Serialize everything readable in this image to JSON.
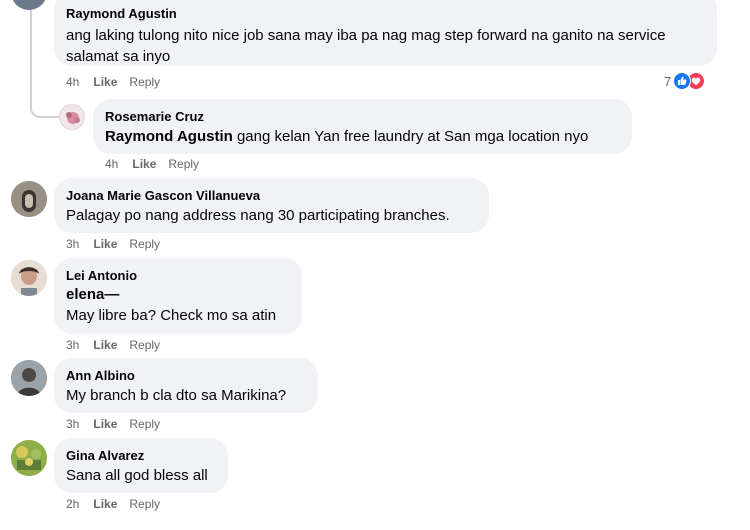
{
  "comments": [
    {
      "author": "Raymond Agustin",
      "text": "ang laking tulong nito nice job sana may iba pa nag mag step forward na ganito na service salamat sa inyo",
      "time": "4h",
      "like": "Like",
      "reply": "Reply",
      "reactions_count": "7"
    },
    {
      "author": "Rosemarie Cruz",
      "mention": "Raymond Agustin",
      "text": " gang kelan Yan free laundry at San mga location nyo",
      "time": "4h",
      "like": "Like",
      "reply": "Reply"
    },
    {
      "author": "Joana Marie Gascon Villanueva",
      "text": "Palagay po nang address nang 30 participating branches.",
      "time": "3h",
      "like": "Like",
      "reply": "Reply"
    },
    {
      "author": "Lei Antonio",
      "mention": "elena—",
      "text": "May libre ba? Check mo sa atin",
      "time": "3h",
      "like": "Like",
      "reply": "Reply"
    },
    {
      "author": "Ann Albino",
      "text": "My branch b cla dto sa Marikina?",
      "time": "3h",
      "like": "Like",
      "reply": "Reply"
    },
    {
      "author": "Gina Alvarez",
      "text": "Sana all god bless all",
      "time": "2h",
      "like": "Like",
      "reply": "Reply"
    }
  ],
  "colors": {
    "bubble": "#f0f2f5",
    "meta": "#65676b",
    "like_blue": "#1877f2",
    "love_red": "#f33e58"
  }
}
